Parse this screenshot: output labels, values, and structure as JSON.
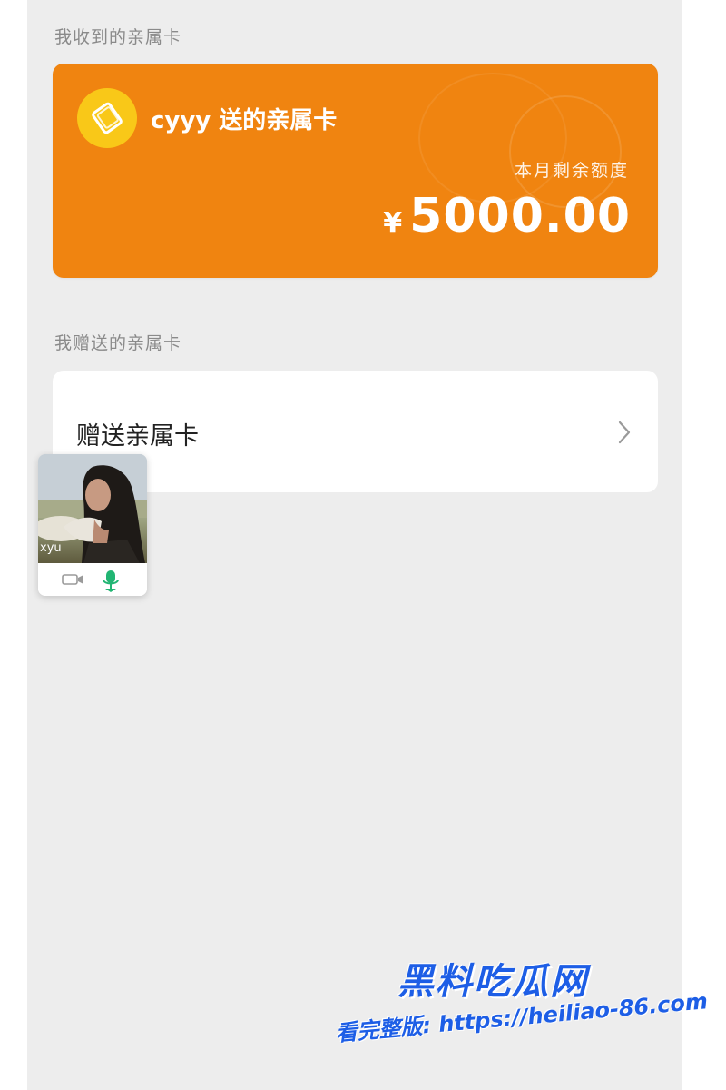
{
  "received_section": {
    "title": "我收到的亲属卡"
  },
  "card": {
    "title": "cyyy 送的亲属卡",
    "subtitle": "本月剩余额度",
    "currency": "¥",
    "amount": "5000.00",
    "color": "#f08410",
    "logo_color": "#f9c818"
  },
  "given_section": {
    "title": "我赠送的亲属卡"
  },
  "give_item": {
    "label": "赠送亲属卡",
    "icon": "chevron-right-icon"
  },
  "floating_video": {
    "name": "xyu",
    "controls": [
      "camera-icon",
      "microphone-icon"
    ]
  },
  "watermark": {
    "brand": "黑料吃瓜网",
    "line": "看完整版: https://heiliao-86.com"
  }
}
